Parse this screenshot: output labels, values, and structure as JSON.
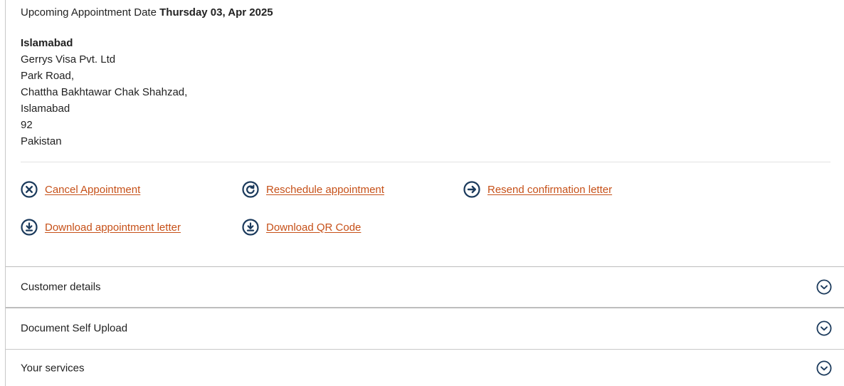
{
  "appointment": {
    "upcoming_prefix": "Upcoming Appointment Date",
    "upcoming_date": "Thursday 03, Apr 2025"
  },
  "address": {
    "city": "Islamabad",
    "lines": [
      "Gerrys Visa Pvt. Ltd",
      "Park Road,",
      "Chattha Bakhtawar Chak Shahzad,",
      "Islamabad",
      "92",
      "Pakistan"
    ]
  },
  "actions": {
    "cancel": {
      "label": "Cancel Appointment",
      "icon": "close-circle-icon"
    },
    "reschedule": {
      "label": "Reschedule appointment",
      "icon": "refresh-circle-icon"
    },
    "resend": {
      "label": "Resend confirmation letter",
      "icon": "arrow-right-circle-icon"
    },
    "download_letter": {
      "label": "Download appointment letter",
      "icon": "download-circle-icon"
    },
    "download_qr": {
      "label": "Download QR Code",
      "icon": "download-circle-icon"
    }
  },
  "accordion": [
    {
      "label": "Customer details",
      "icon": "chevron-down-circle-icon"
    },
    {
      "label": "Document Self Upload",
      "icon": "chevron-down-circle-icon"
    },
    {
      "label": "Your services",
      "icon": "chevron-down-circle-icon"
    }
  ],
  "colors": {
    "link": "#c65018",
    "icon": "#1b3a5c",
    "text": "#222222",
    "border": "#c8c8c8"
  }
}
